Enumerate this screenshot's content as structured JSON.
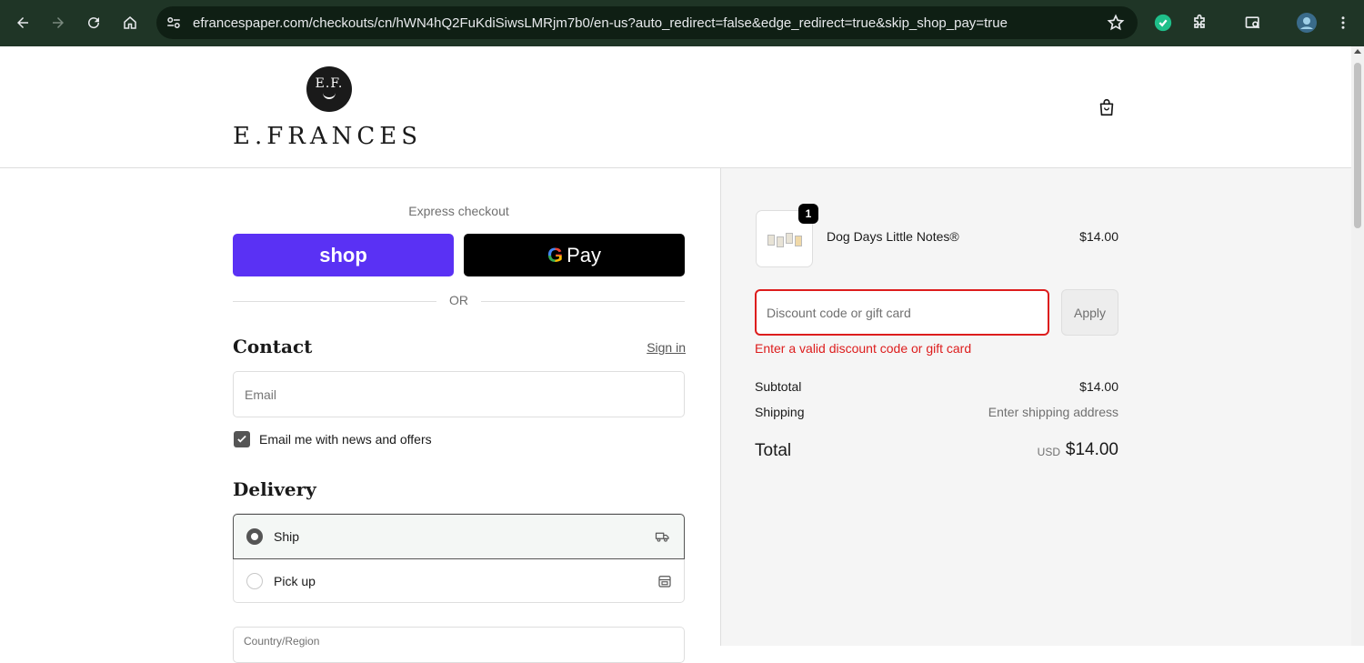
{
  "browser": {
    "url": "efrancespaper.com/checkouts/cn/hWN4hQ2FuKdiSiwsLMRjm7b0/en-us?auto_redirect=false&edge_redirect=true&skip_shop_pay=true"
  },
  "header": {
    "logo_initials": "E.F.",
    "logo_text": "E.FRANCES"
  },
  "express": {
    "label": "Express checkout",
    "shop_label": "shop",
    "gpay_g": "G",
    "gpay_label": "Pay",
    "or_label": "OR"
  },
  "contact": {
    "title": "Contact",
    "sign_in": "Sign in",
    "email_placeholder": "Email",
    "news_label": "Email me with news and offers"
  },
  "delivery": {
    "title": "Delivery",
    "options": [
      {
        "label": "Ship",
        "selected": true
      },
      {
        "label": "Pick up",
        "selected": false
      }
    ],
    "country_label": "Country/Region"
  },
  "order": {
    "item": {
      "name": "Dog Days Little Notes®",
      "price": "$14.00",
      "quantity": "1"
    },
    "discount_placeholder": "Discount code or gift card",
    "apply_label": "Apply",
    "error": "Enter a valid discount code or gift card",
    "subtotal_label": "Subtotal",
    "subtotal_value": "$14.00",
    "shipping_label": "Shipping",
    "shipping_value": "Enter shipping address",
    "total_label": "Total",
    "total_currency": "USD",
    "total_value": "$14.00"
  },
  "colors": {
    "shop_pay": "#5a31f4",
    "error": "#dd1d1d",
    "chrome": "#1f3526"
  }
}
